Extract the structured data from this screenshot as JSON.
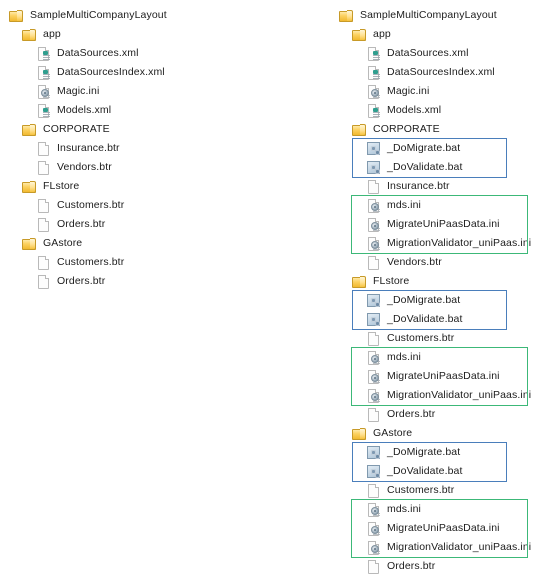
{
  "meta": {
    "view": "windows-explorer-folder-tree-comparison",
    "panels": [
      "before",
      "after"
    ]
  },
  "colors": {
    "folder": "#f1b92f",
    "xml_tag": "#2f9e8f",
    "bat_icon": "#7e99b2",
    "ini_icon": "#7d8f9c",
    "highlight_blue": "#4a7ebb",
    "highlight_green": "#3cb878",
    "text": "#1d1d1d",
    "background": "#ffffff"
  },
  "panels": {
    "before": {
      "rows": [
        {
          "label": "SampleMultiCompanyLayout",
          "icon": "folder-icon",
          "level": 0
        },
        {
          "label": "app",
          "icon": "folder-icon",
          "level": 1
        },
        {
          "label": "DataSources.xml",
          "icon": "xml-file-icon",
          "level": 2
        },
        {
          "label": "DataSourcesIndex.xml",
          "icon": "xml-file-icon",
          "level": 2
        },
        {
          "label": "Magic.ini",
          "icon": "ini-file-icon",
          "level": 2
        },
        {
          "label": "Models.xml",
          "icon": "xml-file-icon",
          "level": 2
        },
        {
          "label": "CORPORATE",
          "icon": "folder-icon",
          "level": 1
        },
        {
          "label": "Insurance.btr",
          "icon": "btr-file-icon",
          "level": 2
        },
        {
          "label": "Vendors.btr",
          "icon": "btr-file-icon",
          "level": 2
        },
        {
          "label": "FLstore",
          "icon": "folder-icon",
          "level": 1
        },
        {
          "label": "Customers.btr",
          "icon": "btr-file-icon",
          "level": 2
        },
        {
          "label": "Orders.btr",
          "icon": "btr-file-icon",
          "level": 2
        },
        {
          "label": "GAstore",
          "icon": "folder-icon",
          "level": 1
        },
        {
          "label": "Customers.btr",
          "icon": "btr-file-icon",
          "level": 2
        },
        {
          "label": "Orders.btr",
          "icon": "btr-file-icon",
          "level": 2
        }
      ]
    },
    "after": {
      "rows": [
        {
          "label": "SampleMultiCompanyLayout",
          "icon": "folder-icon",
          "level": 0,
          "highlight": "none"
        },
        {
          "label": "app",
          "icon": "folder-icon",
          "level": 1,
          "highlight": "none"
        },
        {
          "label": "DataSources.xml",
          "icon": "xml-file-icon",
          "level": 2,
          "highlight": "none"
        },
        {
          "label": "DataSourcesIndex.xml",
          "icon": "xml-file-icon",
          "level": 2,
          "highlight": "none"
        },
        {
          "label": "Magic.ini",
          "icon": "ini-file-icon",
          "level": 2,
          "highlight": "none"
        },
        {
          "label": "Models.xml",
          "icon": "xml-file-icon",
          "level": 2,
          "highlight": "none"
        },
        {
          "label": "CORPORATE",
          "icon": "folder-icon",
          "level": 1,
          "highlight": "none"
        },
        {
          "label": "_DoMigrate.bat",
          "icon": "bat-file-icon",
          "level": 2,
          "highlight": "blue"
        },
        {
          "label": "_DoValidate.bat",
          "icon": "bat-file-icon",
          "level": 2,
          "highlight": "blue"
        },
        {
          "label": "Insurance.btr",
          "icon": "btr-file-icon",
          "level": 2,
          "highlight": "none"
        },
        {
          "label": "mds.ini",
          "icon": "ini-file-icon",
          "level": 2,
          "highlight": "green"
        },
        {
          "label": "MigrateUniPaasData.ini",
          "icon": "ini-file-icon",
          "level": 2,
          "highlight": "green"
        },
        {
          "label": "MigrationValidator_uniPaas.ini",
          "icon": "ini-file-icon",
          "level": 2,
          "highlight": "green"
        },
        {
          "label": "Vendors.btr",
          "icon": "btr-file-icon",
          "level": 2,
          "highlight": "none"
        },
        {
          "label": "FLstore",
          "icon": "folder-icon",
          "level": 1,
          "highlight": "none"
        },
        {
          "label": "_DoMigrate.bat",
          "icon": "bat-file-icon",
          "level": 2,
          "highlight": "blue"
        },
        {
          "label": "_DoValidate.bat",
          "icon": "bat-file-icon",
          "level": 2,
          "highlight": "blue"
        },
        {
          "label": "Customers.btr",
          "icon": "btr-file-icon",
          "level": 2,
          "highlight": "none"
        },
        {
          "label": "mds.ini",
          "icon": "ini-file-icon",
          "level": 2,
          "highlight": "green"
        },
        {
          "label": "MigrateUniPaasData.ini",
          "icon": "ini-file-icon",
          "level": 2,
          "highlight": "green"
        },
        {
          "label": "MigrationValidator_uniPaas.ini",
          "icon": "ini-file-icon",
          "level": 2,
          "highlight": "green"
        },
        {
          "label": "Orders.btr",
          "icon": "btr-file-icon",
          "level": 2,
          "highlight": "none"
        },
        {
          "label": "GAstore",
          "icon": "folder-icon",
          "level": 1,
          "highlight": "none"
        },
        {
          "label": "_DoMigrate.bat",
          "icon": "bat-file-icon",
          "level": 2,
          "highlight": "blue"
        },
        {
          "label": "_DoValidate.bat",
          "icon": "bat-file-icon",
          "level": 2,
          "highlight": "blue"
        },
        {
          "label": "Customers.btr",
          "icon": "btr-file-icon",
          "level": 2,
          "highlight": "none"
        },
        {
          "label": "mds.ini",
          "icon": "ini-file-icon",
          "level": 2,
          "highlight": "green"
        },
        {
          "label": "MigrateUniPaasData.ini",
          "icon": "ini-file-icon",
          "level": 2,
          "highlight": "green"
        },
        {
          "label": "MigrationValidator_uniPaas.ini",
          "icon": "ini-file-icon",
          "level": 2,
          "highlight": "green"
        },
        {
          "label": "Orders.btr",
          "icon": "btr-file-icon",
          "level": 2,
          "highlight": "none"
        }
      ]
    }
  }
}
